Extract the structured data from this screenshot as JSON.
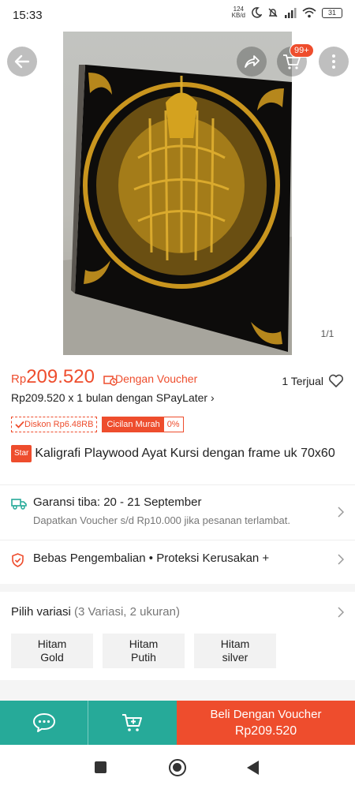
{
  "status_bar": {
    "time": "15:33",
    "net_speed_value": "124",
    "net_speed_unit": "KB/d",
    "battery": "31",
    "icons": [
      "moon-icon",
      "bell-off-icon",
      "signal-icon",
      "wifi-icon",
      "battery-icon"
    ]
  },
  "header": {
    "cart_badge": "99+",
    "icons": [
      "back-arrow-icon",
      "share-icon",
      "cart-icon",
      "more-vertical-icon"
    ]
  },
  "gallery": {
    "counter": "1/1"
  },
  "price": {
    "currency": "Rp",
    "amount": "209.520",
    "voucher_label": "Dengan Voucher",
    "sold": "1 Terjual",
    "paylater": "Rp209.520 x 1 bulan dengan SPayLater",
    "paylater_chevron": "›"
  },
  "badges": {
    "diskon": "Diskon Rp6.48RB",
    "cicilan_label": "Cicilan Murah",
    "cicilan_pct": "0%"
  },
  "product": {
    "tag": "Star",
    "title": "Kaligrafi Playwood Ayat Kursi dengan frame uk 70x60"
  },
  "shipping": {
    "title": "Garansi tiba: 20 - 21 September",
    "subtitle": "Dapatkan Voucher s/d Rp10.000 jika pesanan terlambat."
  },
  "protection": {
    "text": "Bebas Pengembalian  •  Proteksi Kerusakan +"
  },
  "variations": {
    "label": "Pilih variasi",
    "meta": "(3 Variasi, 2 ukuran)",
    "options": [
      {
        "line1": "Hitam",
        "line2": "Gold"
      },
      {
        "line1": "Hitam",
        "line2": "Putih"
      },
      {
        "line1": "Hitam",
        "line2": "silver"
      }
    ]
  },
  "bottom_bar": {
    "buy_label": "Beli Dengan Voucher",
    "buy_price": "Rp209.520"
  },
  "colors": {
    "accent": "#ee4d2d",
    "teal": "#26aa99",
    "gold": "#c9951e"
  }
}
